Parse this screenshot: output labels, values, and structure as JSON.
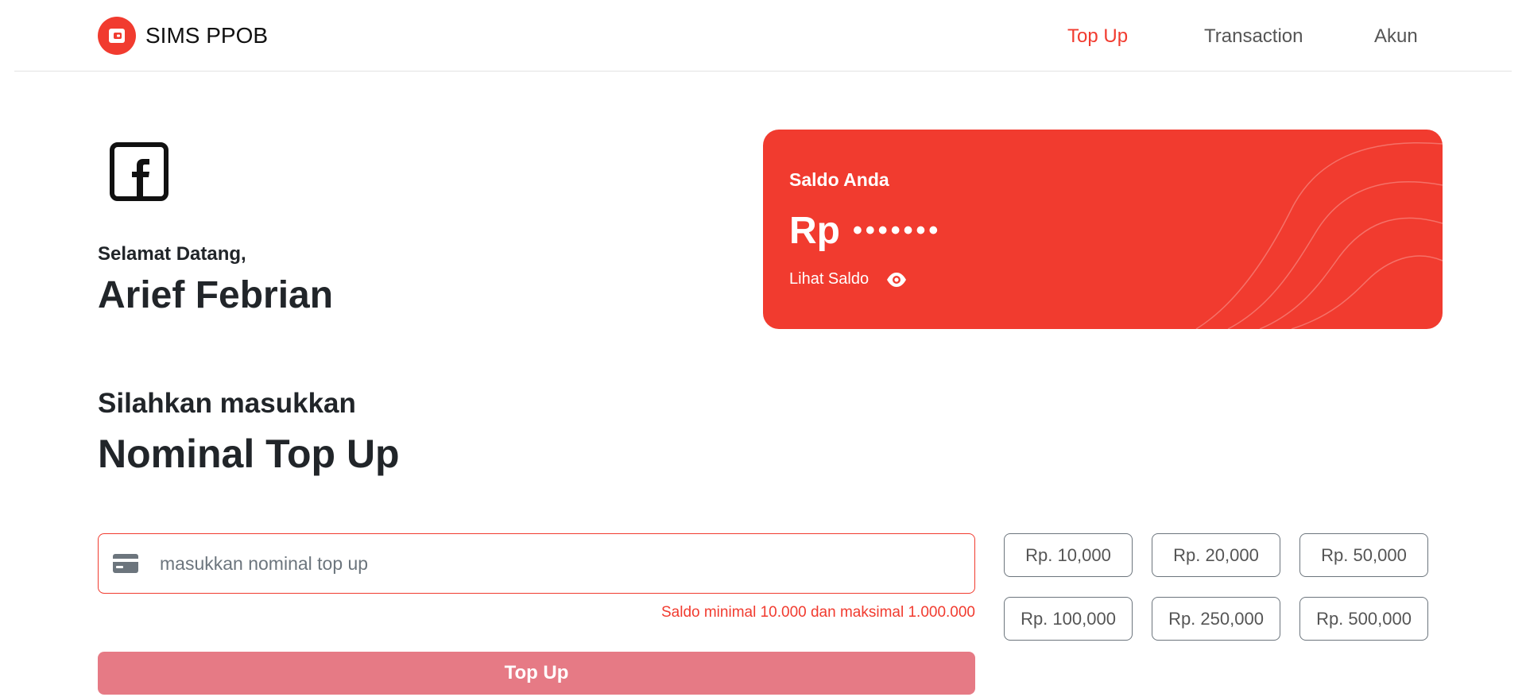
{
  "brand": {
    "name": "SIMS PPOB",
    "logo_icon": "wallet-icon",
    "color": "#f13b2f"
  },
  "nav": [
    {
      "label": "Top Up",
      "active": true
    },
    {
      "label": "Transaction",
      "active": false
    },
    {
      "label": "Akun",
      "active": false
    }
  ],
  "profile": {
    "avatar_icon": "facebook-icon",
    "welcome": "Selamat Datang,",
    "name": "Arief Febrian"
  },
  "balance": {
    "label": "Saldo Anda",
    "prefix": "Rp",
    "masked_value": "•••••••",
    "toggle_label": "Lihat Saldo",
    "toggle_icon": "eye-icon",
    "card_color": "#f13b2f"
  },
  "topup": {
    "prompt": "Silahkan masukkan",
    "heading": "Nominal Top Up",
    "input_placeholder": "masukkan nominal top up",
    "input_value": "",
    "input_icon": "credit-card-icon",
    "error": "Saldo minimal 10.000 dan maksimal 1.000.000",
    "submit_label": "Top Up",
    "submit_color": "#e67a85",
    "presets": [
      "Rp. 10,000",
      "Rp. 20,000",
      "Rp. 50,000",
      "Rp. 100,000",
      "Rp. 250,000",
      "Rp. 500,000"
    ]
  }
}
